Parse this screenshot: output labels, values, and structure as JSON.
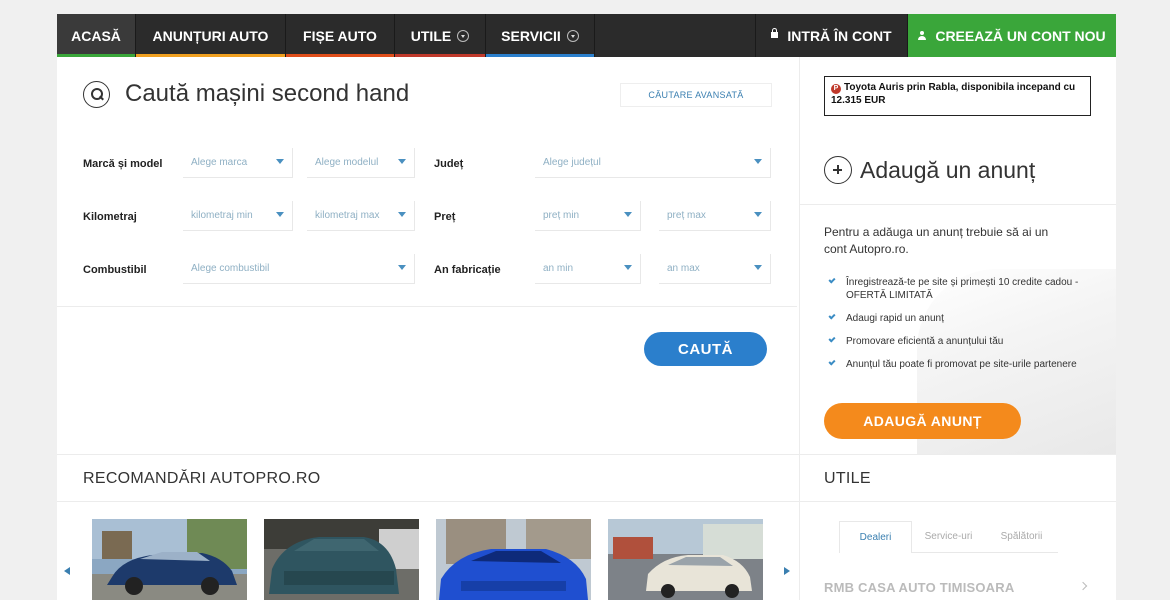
{
  "nav": {
    "items": [
      {
        "label": "ACASĂ",
        "color": "#3aa63a"
      },
      {
        "label": "ANUNȚURI AUTO",
        "color": "#f0a020"
      },
      {
        "label": "FIȘE AUTO",
        "color": "#e04e1a"
      },
      {
        "label": "UTILE",
        "color": "#c0392b"
      },
      {
        "label": "SERVICII",
        "color": "#2b7fcc"
      }
    ],
    "login_label": "INTRĂ ÎN CONT",
    "signup_label": "CREEAZĂ UN CONT NOU"
  },
  "search": {
    "title": "Caută mașini second hand",
    "advanced_label": "CĂUTARE AVANSATĂ",
    "labels": {
      "make_model": "Marcă și model",
      "county": "Județ",
      "km": "Kilometraj",
      "price": "Preț",
      "fuel": "Combustibil",
      "year": "An fabricație"
    },
    "selects": {
      "make": "Alege marca",
      "model": "Alege modelul",
      "county": "Alege județul",
      "km_min": "kilometraj min",
      "km_max": "kilometraj max",
      "price_min": "preț min",
      "price_max": "preț max",
      "fuel": "Alege combustibil",
      "year_min": "an min",
      "year_max": "an max"
    },
    "button_label": "CAUTĂ"
  },
  "promo": {
    "badge": "P",
    "text": "Toyota Auris prin Rabla, disponibila incepand cu 12.315 EUR"
  },
  "add_listing": {
    "title": "Adaugă un anunț",
    "intro": "Pentru a adăuga un anunț trebuie să ai un cont Autopro.ro.",
    "benefits": [
      "Înregistrează-te pe site și primești 10 credite cadou - OFERTĂ LIMITATĂ",
      "Adaugi rapid un anunț",
      "Promovare eficientă a anunțului tău",
      "Anunțul tău poate fi promovat pe site-urile partenere"
    ],
    "button_label": "ADAUGĂ ANUNȚ"
  },
  "recommendations": {
    "title": "RECOMANDĂRI AUTOPRO.RO",
    "cars": [
      {
        "body": "#1d3a6b"
      },
      {
        "body": "#2f5560"
      },
      {
        "body": "#1f4fd0"
      },
      {
        "body": "#e8e4d8"
      }
    ]
  },
  "utile": {
    "title": "UTILE",
    "tabs": [
      "Dealeri",
      "Service-uri",
      "Spălătorii"
    ],
    "first_dealer": "RMB CASA AUTO TIMISOARA"
  }
}
